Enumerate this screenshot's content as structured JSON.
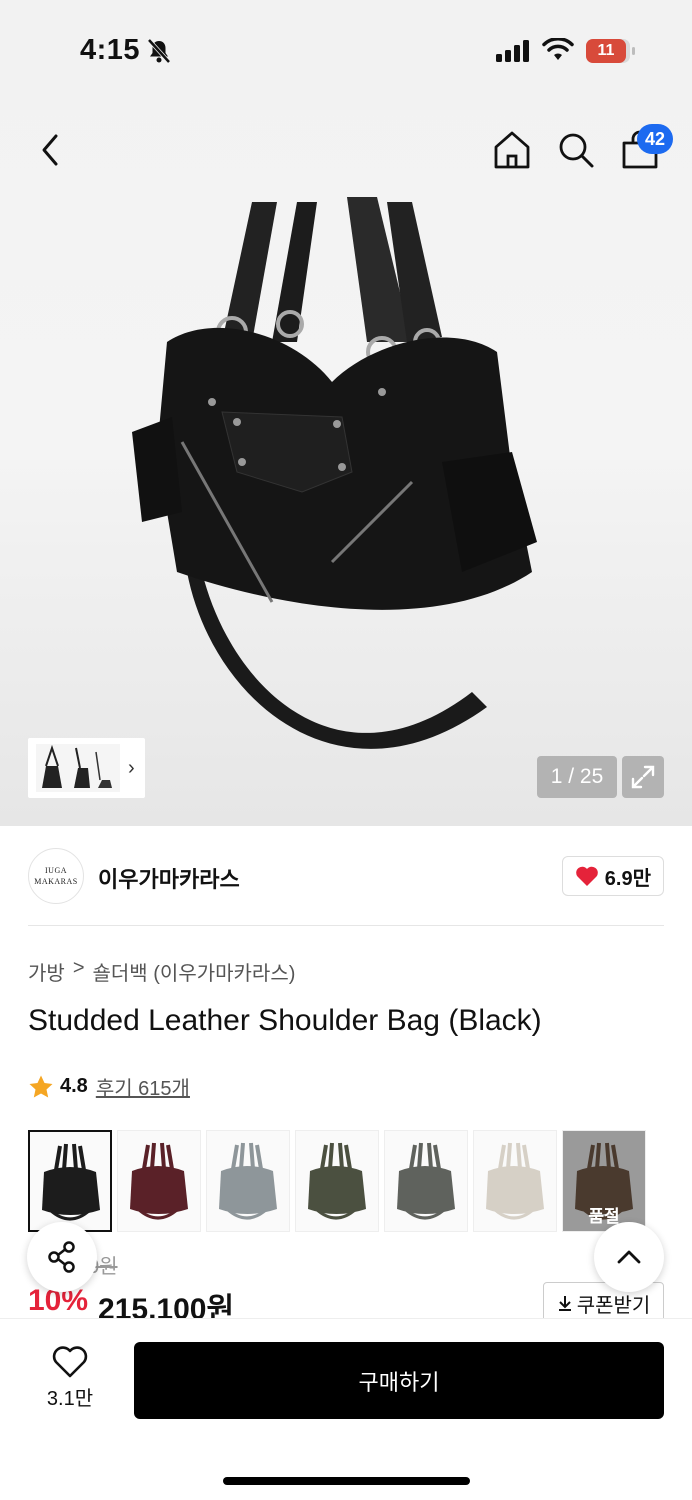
{
  "status_bar": {
    "time": "4:15",
    "battery": "11"
  },
  "nav": {
    "cart_count": "42"
  },
  "gallery": {
    "counter": "1 / 25"
  },
  "brand": {
    "logo_line1": "IUGA",
    "logo_line2": "MAKARAS",
    "name": "이우가마카라스",
    "likes": "6.9만"
  },
  "breadcrumb": {
    "level1": "가방",
    "separator": ">",
    "level2": "숄더백 (이우가마카라스)"
  },
  "product": {
    "title": "Studded Leather Shoulder Bag (Black)",
    "rating": "4.8",
    "reviews": "후기 615개",
    "original_price": "0원",
    "discount": "10%",
    "price": "215,100원"
  },
  "swatches": [
    {
      "color": "#1c1c1c",
      "label": ""
    },
    {
      "color": "#5a2128",
      "label": ""
    },
    {
      "color": "#8e969a",
      "label": ""
    },
    {
      "color": "#4b5040",
      "label": ""
    },
    {
      "color": "#5f625d",
      "label": ""
    },
    {
      "color": "#d6d0c6",
      "label": ""
    },
    {
      "color": "#4a3a2e",
      "label": "품절"
    }
  ],
  "actions": {
    "coupon": "쿠폰받기",
    "wish_count": "3.1만",
    "buy": "구매하기"
  },
  "colors": {
    "badge": "#1c6af0",
    "discount": "#e5233a",
    "heart": "#e5233a"
  }
}
